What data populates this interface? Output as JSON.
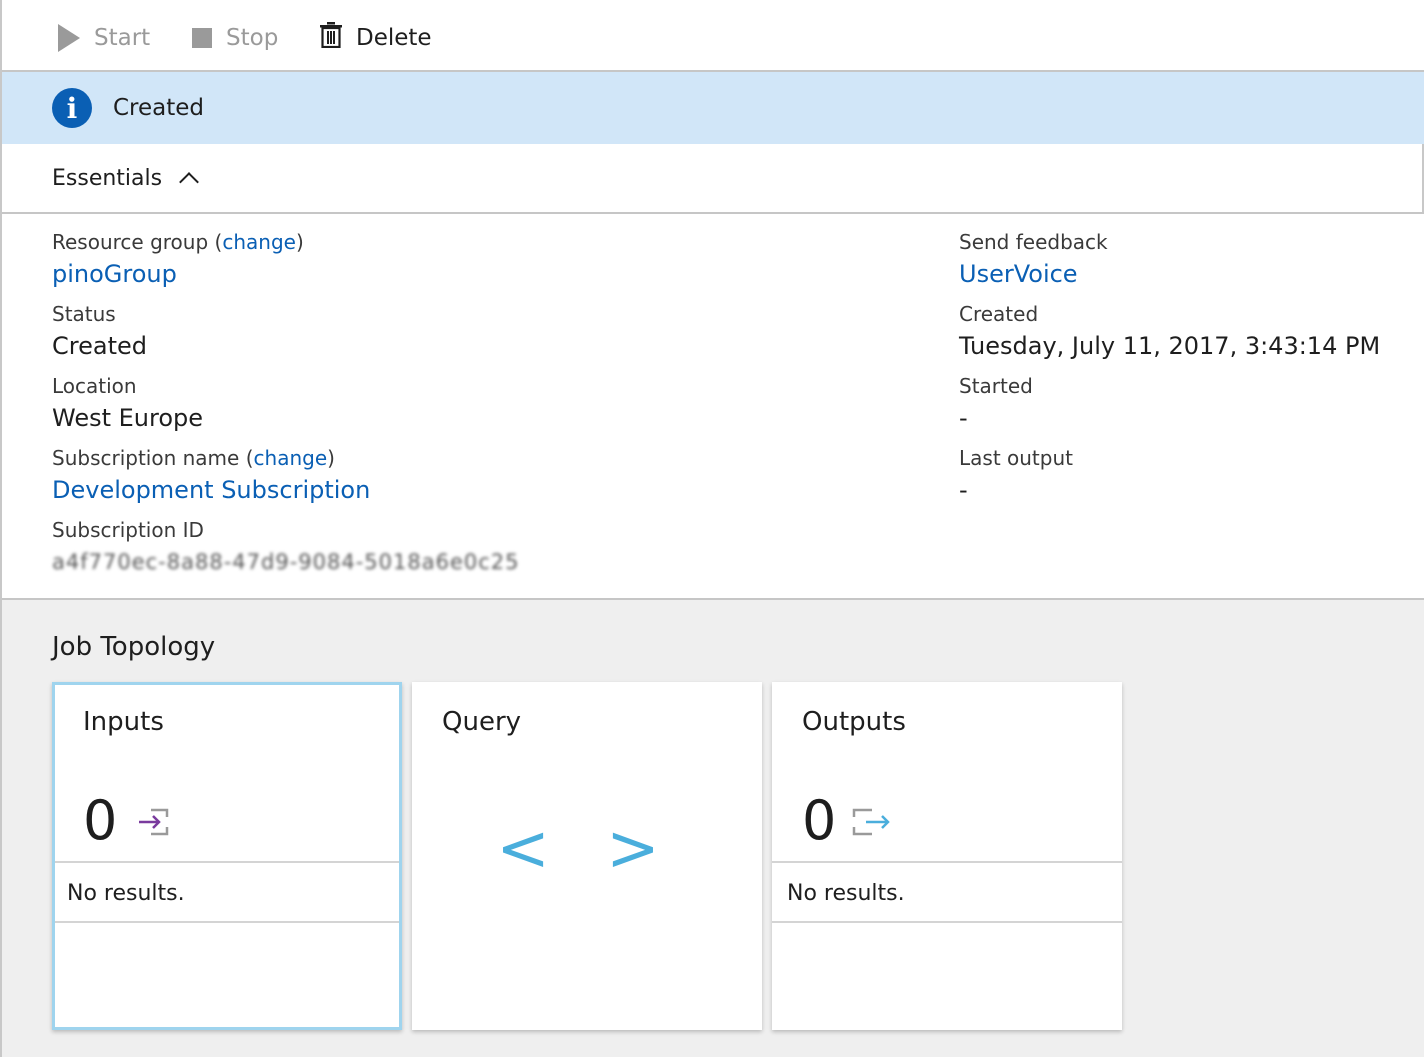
{
  "toolbar": {
    "start_label": "Start",
    "stop_label": "Stop",
    "delete_label": "Delete"
  },
  "status_banner": {
    "text": "Created",
    "icon": "info-icon"
  },
  "essentials": {
    "header": "Essentials",
    "left": {
      "resource_group_label": "Resource group",
      "resource_group_change": "change",
      "resource_group_value": "pinoGroup",
      "status_label": "Status",
      "status_value": "Created",
      "location_label": "Location",
      "location_value": "West Europe",
      "subscription_name_label": "Subscription name",
      "subscription_name_change": "change",
      "subscription_name_value": "Development Subscription",
      "subscription_id_label": "Subscription ID",
      "subscription_id_value": "a4f770ec-8a88-47d9-9084-5018a6e0c25"
    },
    "right": {
      "feedback_label": "Send feedback",
      "feedback_value": "UserVoice",
      "created_label": "Created",
      "created_value": "Tuesday, July 11, 2017, 3:43:14 PM",
      "started_label": "Started",
      "started_value": "-",
      "last_output_label": "Last output",
      "last_output_value": "-"
    }
  },
  "topology": {
    "title": "Job Topology",
    "inputs": {
      "title": "Inputs",
      "count": "0",
      "message": "No results."
    },
    "query": {
      "title": "Query",
      "glyph": "< >"
    },
    "outputs": {
      "title": "Outputs",
      "count": "0",
      "message": "No results."
    }
  },
  "colors": {
    "accent": "#0a5fb4",
    "banner_bg": "#d1e6f8",
    "query_glyph": "#4aaedc",
    "input_icon": "#7a3b9e",
    "output_icon": "#4aaedc"
  }
}
